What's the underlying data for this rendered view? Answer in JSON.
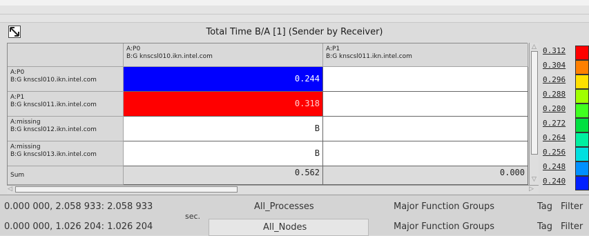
{
  "title": "Total Time B/A [1] (Sender by Receiver)",
  "columns": [
    {
      "a": "A:P0",
      "b": "B:G knscsl010.ikn.intel.com"
    },
    {
      "a": "A:P1",
      "b": "B:G knscsl011.ikn.intel.com"
    }
  ],
  "rows": [
    {
      "a": "A:P0",
      "b": "B:G knscsl010.ikn.intel.com",
      "cells": [
        "0.244",
        ""
      ],
      "colors": [
        "#0000ff",
        "#ffffff"
      ]
    },
    {
      "a": "A:P1",
      "b": "B:G knscsl011.ikn.intel.com",
      "cells": [
        "0.318",
        ""
      ],
      "colors": [
        "#ff0000",
        "#ffffff"
      ]
    },
    {
      "a": "A:missing",
      "b": "B:G knscsl012.ikn.intel.com",
      "cells": [
        "B",
        ""
      ],
      "colors": [
        "#ffffff",
        "#ffffff"
      ]
    },
    {
      "a": "A:missing",
      "b": "B:G knscsl013.ikn.intel.com",
      "cells": [
        "B",
        ""
      ],
      "colors": [
        "#ffffff",
        "#ffffff"
      ]
    }
  ],
  "sum": {
    "label": "Sum",
    "cells": [
      "0.562",
      "0.000"
    ]
  },
  "legend": [
    {
      "value": "0.312",
      "color": "#ff0000"
    },
    {
      "value": "0.304",
      "color": "#ff8000"
    },
    {
      "value": "0.296",
      "color": "#ffe000"
    },
    {
      "value": "0.288",
      "color": "#a0ff00"
    },
    {
      "value": "0.280",
      "color": "#40ff20"
    },
    {
      "value": "0.272",
      "color": "#00e040"
    },
    {
      "value": "0.264",
      "color": "#00f0a0"
    },
    {
      "value": "0.256",
      "color": "#00e0e0"
    },
    {
      "value": "0.248",
      "color": "#0090ff"
    },
    {
      "value": "0.240",
      "color": "#0020ff"
    }
  ],
  "bottom": {
    "range1": "0.000 000, 2.058 933: 2.058 933",
    "range2": "0.000 000, 1.026 204: 1.026 204",
    "sec": "sec.",
    "processes": "All_Processes",
    "nodes": "All_Nodes",
    "groups1": "Major Function Groups",
    "groups2": "Major Function Groups",
    "tag": "Tag",
    "filter": "Filter"
  }
}
